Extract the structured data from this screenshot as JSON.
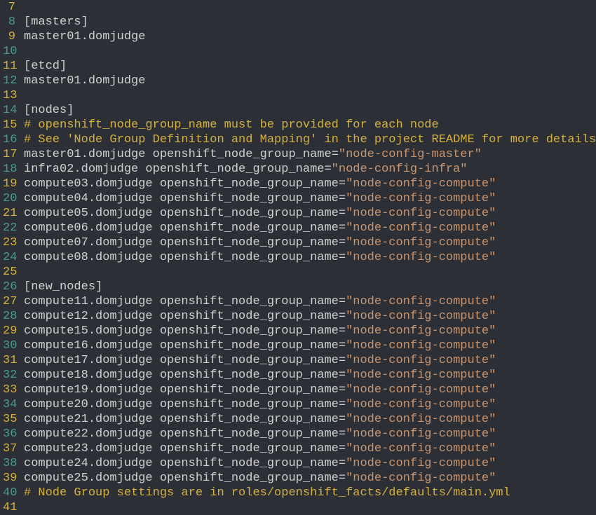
{
  "lines": [
    {
      "num": "7",
      "spans": [
        {
          "text": "",
          "cls": "text-default"
        }
      ]
    },
    {
      "num": "8",
      "spans": [
        {
          "text": "[masters]",
          "cls": "text-default"
        }
      ]
    },
    {
      "num": "9",
      "spans": [
        {
          "text": "master01.domjudge",
          "cls": "text-default"
        }
      ]
    },
    {
      "num": "10",
      "spans": [
        {
          "text": "",
          "cls": "text-default"
        }
      ]
    },
    {
      "num": "11",
      "spans": [
        {
          "text": "[etcd]",
          "cls": "text-default"
        }
      ]
    },
    {
      "num": "12",
      "spans": [
        {
          "text": "master01.domjudge",
          "cls": "text-default"
        }
      ]
    },
    {
      "num": "13",
      "spans": [
        {
          "text": "",
          "cls": "text-default"
        }
      ]
    },
    {
      "num": "14",
      "spans": [
        {
          "text": "[nodes]",
          "cls": "text-default"
        }
      ]
    },
    {
      "num": "15",
      "spans": [
        {
          "text": "# openshift_node_group_name must be provided for each node",
          "cls": "text-comment"
        }
      ]
    },
    {
      "num": "16",
      "spans": [
        {
          "text": "# See 'Node Group Definition and Mapping' in the project README for more details",
          "cls": "text-comment"
        }
      ]
    },
    {
      "num": "17",
      "spans": [
        {
          "text": "master01.domjudge openshift_node_group_name=",
          "cls": "text-default"
        },
        {
          "text": "\"node-config-master\"",
          "cls": "text-string"
        }
      ]
    },
    {
      "num": "18",
      "spans": [
        {
          "text": "infra02.domjudge openshift_node_group_name=",
          "cls": "text-default"
        },
        {
          "text": "\"node-config-infra\"",
          "cls": "text-string"
        }
      ]
    },
    {
      "num": "19",
      "spans": [
        {
          "text": "compute03.domjudge openshift_node_group_name=",
          "cls": "text-default"
        },
        {
          "text": "\"node-config-compute\"",
          "cls": "text-string"
        }
      ]
    },
    {
      "num": "20",
      "spans": [
        {
          "text": "compute04.domjudge openshift_node_group_name=",
          "cls": "text-default"
        },
        {
          "text": "\"node-config-compute\"",
          "cls": "text-string"
        }
      ]
    },
    {
      "num": "21",
      "spans": [
        {
          "text": "compute05.domjudge openshift_node_group_name=",
          "cls": "text-default"
        },
        {
          "text": "\"node-config-compute\"",
          "cls": "text-string"
        }
      ]
    },
    {
      "num": "22",
      "spans": [
        {
          "text": "compute06.domjudge openshift_node_group_name=",
          "cls": "text-default"
        },
        {
          "text": "\"node-config-compute\"",
          "cls": "text-string"
        }
      ]
    },
    {
      "num": "23",
      "spans": [
        {
          "text": "compute07.domjudge openshift_node_group_name=",
          "cls": "text-default"
        },
        {
          "text": "\"node-config-compute\"",
          "cls": "text-string"
        }
      ]
    },
    {
      "num": "24",
      "spans": [
        {
          "text": "compute08.domjudge openshift_node_group_name=",
          "cls": "text-default"
        },
        {
          "text": "\"node-config-compute\"",
          "cls": "text-string"
        }
      ]
    },
    {
      "num": "25",
      "spans": [
        {
          "text": "",
          "cls": "text-default"
        }
      ]
    },
    {
      "num": "26",
      "spans": [
        {
          "text": "[new_nodes]",
          "cls": "text-default"
        }
      ]
    },
    {
      "num": "27",
      "spans": [
        {
          "text": "compute11.domjudge openshift_node_group_name=",
          "cls": "text-default"
        },
        {
          "text": "\"node-config-compute\"",
          "cls": "text-string"
        }
      ]
    },
    {
      "num": "28",
      "spans": [
        {
          "text": "compute12.domjudge openshift_node_group_name=",
          "cls": "text-default"
        },
        {
          "text": "\"node-config-compute\"",
          "cls": "text-string"
        }
      ]
    },
    {
      "num": "29",
      "spans": [
        {
          "text": "compute15.domjudge openshift_node_group_name=",
          "cls": "text-default"
        },
        {
          "text": "\"node-config-compute\"",
          "cls": "text-string"
        }
      ]
    },
    {
      "num": "30",
      "spans": [
        {
          "text": "compute16.domjudge openshift_node_group_name=",
          "cls": "text-default"
        },
        {
          "text": "\"node-config-compute\"",
          "cls": "text-string"
        }
      ]
    },
    {
      "num": "31",
      "spans": [
        {
          "text": "compute17.domjudge openshift_node_group_name=",
          "cls": "text-default"
        },
        {
          "text": "\"node-config-compute\"",
          "cls": "text-string"
        }
      ]
    },
    {
      "num": "32",
      "spans": [
        {
          "text": "compute18.domjudge openshift_node_group_name=",
          "cls": "text-default"
        },
        {
          "text": "\"node-config-compute\"",
          "cls": "text-string"
        }
      ]
    },
    {
      "num": "33",
      "spans": [
        {
          "text": "compute19.domjudge openshift_node_group_name=",
          "cls": "text-default"
        },
        {
          "text": "\"node-config-compute\"",
          "cls": "text-string"
        }
      ]
    },
    {
      "num": "34",
      "spans": [
        {
          "text": "compute20.domjudge openshift_node_group_name=",
          "cls": "text-default"
        },
        {
          "text": "\"node-config-compute\"",
          "cls": "text-string"
        }
      ]
    },
    {
      "num": "35",
      "spans": [
        {
          "text": "compute21.domjudge openshift_node_group_name=",
          "cls": "text-default"
        },
        {
          "text": "\"node-config-compute\"",
          "cls": "text-string"
        }
      ]
    },
    {
      "num": "36",
      "spans": [
        {
          "text": "compute22.domjudge openshift_node_group_name=",
          "cls": "text-default"
        },
        {
          "text": "\"node-config-compute\"",
          "cls": "text-string"
        }
      ]
    },
    {
      "num": "37",
      "spans": [
        {
          "text": "compute23.domjudge openshift_node_group_name=",
          "cls": "text-default"
        },
        {
          "text": "\"node-config-compute\"",
          "cls": "text-string"
        }
      ]
    },
    {
      "num": "38",
      "spans": [
        {
          "text": "compute24.domjudge openshift_node_group_name=",
          "cls": "text-default"
        },
        {
          "text": "\"node-config-compute\"",
          "cls": "text-string"
        }
      ]
    },
    {
      "num": "39",
      "spans": [
        {
          "text": "compute25.domjudge openshift_node_group_name=",
          "cls": "text-default"
        },
        {
          "text": "\"node-config-compute\"",
          "cls": "text-string"
        }
      ]
    },
    {
      "num": "40",
      "spans": [
        {
          "text": "# Node Group settings are in roles/openshift_facts/defaults/main.yml",
          "cls": "text-comment"
        }
      ]
    },
    {
      "num": "41",
      "spans": [
        {
          "text": "",
          "cls": "text-default"
        }
      ]
    }
  ]
}
